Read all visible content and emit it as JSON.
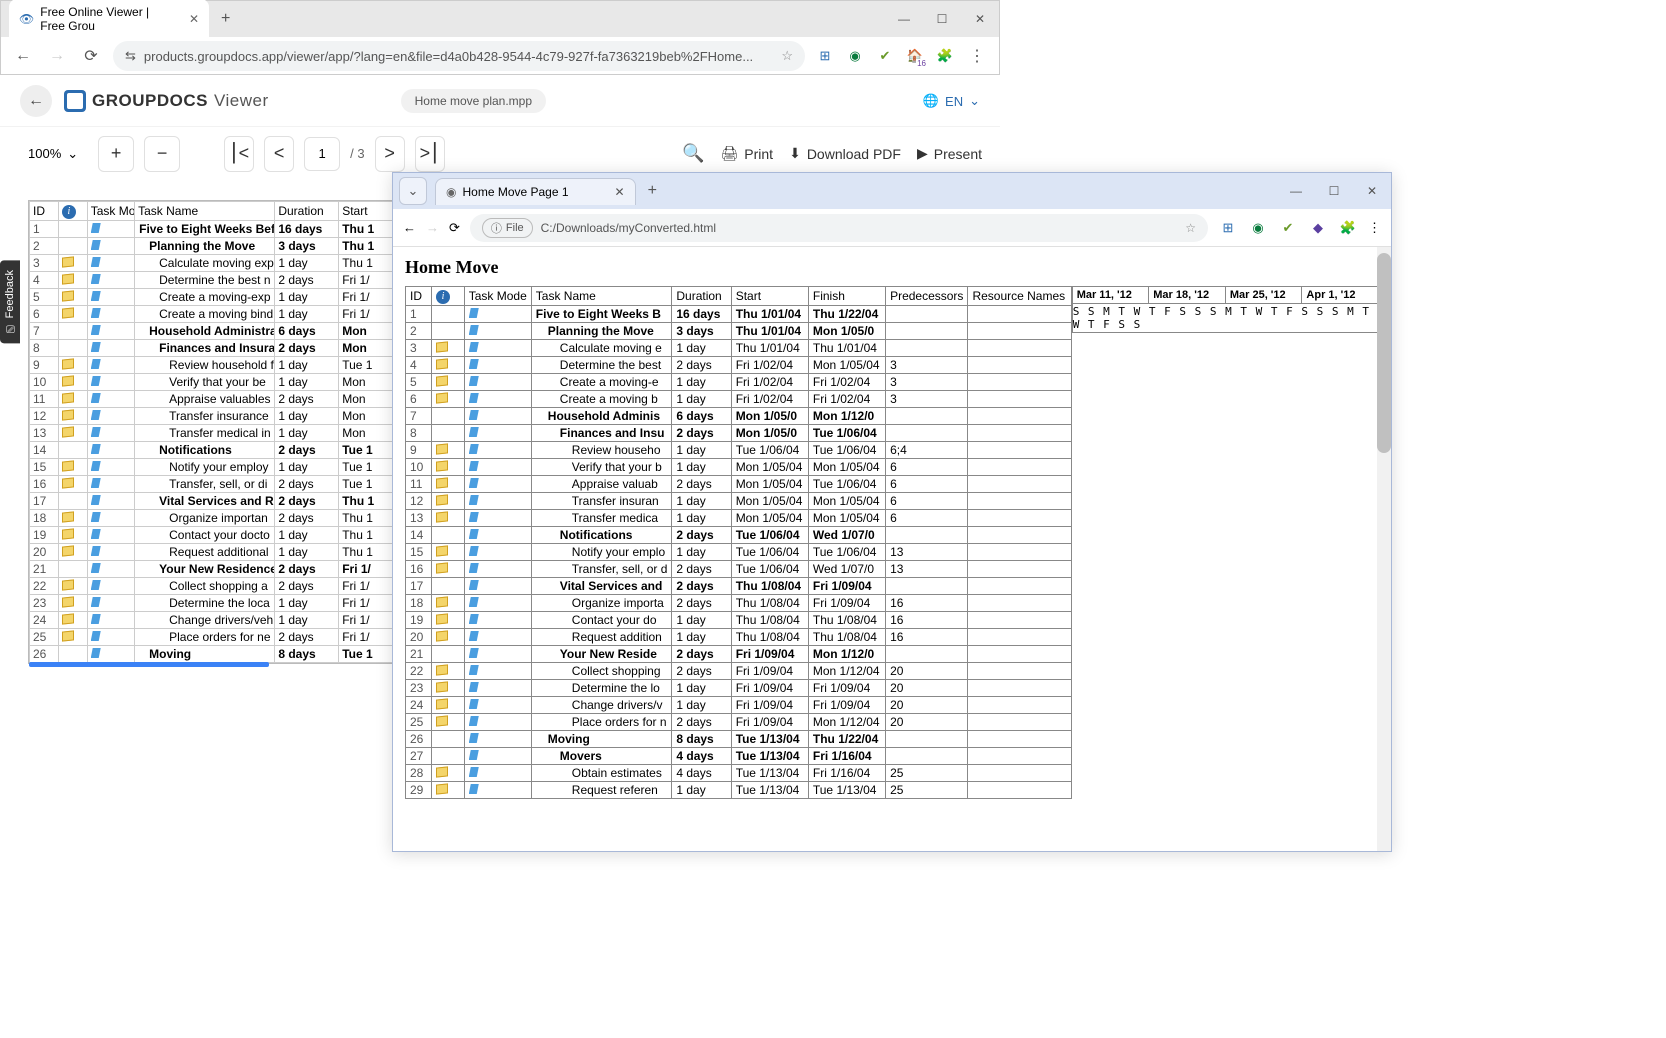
{
  "back_browser": {
    "tab_title": "Free Online Viewer | Free Grou",
    "url": "products.groupdocs.app/viewer/app/?lang=en&file=d4a0b428-9544-4c79-927f-fa7363219beb%2FHome...",
    "win_min": "—",
    "win_max": "☐",
    "win_close": "✕",
    "ext_badge": "16"
  },
  "gd": {
    "brand": "GROUPDOCS",
    "product": "Viewer",
    "file": "Home move plan.mpp",
    "lang": "EN",
    "zoom": "100%",
    "page": "1",
    "total": "/ 3",
    "print": "Print",
    "download": "Download PDF",
    "present": "Present"
  },
  "feedback": "Feedback",
  "back_table": {
    "headers": {
      "id": "ID",
      "info": "",
      "mode": "Task Mode",
      "name": "Task Name",
      "duration": "Duration",
      "start": "Start"
    },
    "rows": [
      {
        "id": "1",
        "b": true,
        "name": "Five to Eight Weeks Before",
        "dur": "16 days",
        "start": "Thu 1",
        "ind": 0,
        "note": false
      },
      {
        "id": "2",
        "b": true,
        "name": "Planning the Move",
        "dur": "3 days",
        "start": "Thu 1",
        "ind": 1,
        "note": false
      },
      {
        "id": "3",
        "b": false,
        "name": "Calculate moving exp",
        "dur": "1 day",
        "start": "Thu 1",
        "ind": 2,
        "note": true
      },
      {
        "id": "4",
        "b": false,
        "name": "Determine the best n",
        "dur": "2 days",
        "start": "Fri 1/",
        "ind": 2,
        "note": true
      },
      {
        "id": "5",
        "b": false,
        "name": "Create a moving-exp",
        "dur": "1 day",
        "start": "Fri 1/",
        "ind": 2,
        "note": true
      },
      {
        "id": "6",
        "b": false,
        "name": "Create a moving bind",
        "dur": "1 day",
        "start": "Fri 1/",
        "ind": 2,
        "note": true
      },
      {
        "id": "7",
        "b": true,
        "name": "Household Administration",
        "dur": "6 days",
        "start": "Mon",
        "ind": 1,
        "note": false
      },
      {
        "id": "8",
        "b": true,
        "name": "Finances and Insura",
        "dur": "2 days",
        "start": "Mon",
        "ind": 2,
        "note": false
      },
      {
        "id": "9",
        "b": false,
        "name": "Review household fi",
        "dur": "1 day",
        "start": "Tue 1",
        "ind": 3,
        "note": true
      },
      {
        "id": "10",
        "b": false,
        "name": "Verify that your be",
        "dur": "1 day",
        "start": "Mon",
        "ind": 3,
        "note": true
      },
      {
        "id": "11",
        "b": false,
        "name": "Appraise valuables",
        "dur": "2 days",
        "start": "Mon",
        "ind": 3,
        "note": true
      },
      {
        "id": "12",
        "b": false,
        "name": "Transfer insurance",
        "dur": "1 day",
        "start": "Mon",
        "ind": 3,
        "note": true
      },
      {
        "id": "13",
        "b": false,
        "name": "Transfer medical in",
        "dur": "1 day",
        "start": "Mon",
        "ind": 3,
        "note": true
      },
      {
        "id": "14",
        "b": true,
        "name": "Notifications",
        "dur": "2 days",
        "start": "Tue 1",
        "ind": 2,
        "note": false
      },
      {
        "id": "15",
        "b": false,
        "name": "Notify your employ",
        "dur": "1 day",
        "start": "Tue 1",
        "ind": 3,
        "note": true
      },
      {
        "id": "16",
        "b": false,
        "name": "Transfer, sell, or di",
        "dur": "2 days",
        "start": "Tue 1",
        "ind": 3,
        "note": true
      },
      {
        "id": "17",
        "b": true,
        "name": "Vital Services and R",
        "dur": "2 days",
        "start": "Thu 1",
        "ind": 2,
        "note": false
      },
      {
        "id": "18",
        "b": false,
        "name": "Organize importan",
        "dur": "2 days",
        "start": "Thu 1",
        "ind": 3,
        "note": true
      },
      {
        "id": "19",
        "b": false,
        "name": "Contact your docto",
        "dur": "1 day",
        "start": "Thu 1",
        "ind": 3,
        "note": true
      },
      {
        "id": "20",
        "b": false,
        "name": "Request additional",
        "dur": "1 day",
        "start": "Thu 1",
        "ind": 3,
        "note": true
      },
      {
        "id": "21",
        "b": true,
        "name": "Your New Residence",
        "dur": "2 days",
        "start": "Fri 1/",
        "ind": 2,
        "note": false
      },
      {
        "id": "22",
        "b": false,
        "name": "Collect shopping a",
        "dur": "2 days",
        "start": "Fri 1/",
        "ind": 3,
        "note": true
      },
      {
        "id": "23",
        "b": false,
        "name": "Determine the loca",
        "dur": "1 day",
        "start": "Fri 1/",
        "ind": 3,
        "note": true
      },
      {
        "id": "24",
        "b": false,
        "name": "Change drivers/veh",
        "dur": "1 day",
        "start": "Fri 1/",
        "ind": 3,
        "note": true
      },
      {
        "id": "25",
        "b": false,
        "name": "Place orders for ne",
        "dur": "2 days",
        "start": "Fri 1/",
        "ind": 3,
        "note": true
      },
      {
        "id": "26",
        "b": true,
        "name": "Moving",
        "dur": "8 days",
        "start": "Tue 1",
        "ind": 1,
        "note": false
      }
    ]
  },
  "front_browser": {
    "tab_title": "Home Move Page 1",
    "file_label": "File",
    "path": "C:/Downloads/myConverted.html",
    "win_min": "—",
    "win_max": "☐",
    "win_close": "✕"
  },
  "front_page": {
    "title": "Home Move",
    "headers": {
      "id": "ID",
      "mode": "Task Mode",
      "name": "Task Name",
      "dur": "Duration",
      "start": "Start",
      "finish": "Finish",
      "pred": "Predecessors",
      "res": "Resource Names"
    },
    "weeks": [
      "Mar 11, '12",
      "Mar 18, '12",
      "Mar 25, '12",
      "Apr 1, '12"
    ],
    "days": "S S M T W T F S S S M T W T F S S S M T W T F S S",
    "rows": [
      {
        "id": "1",
        "b": true,
        "name": "Five to Eight Weeks B",
        "dur": "16 days",
        "start": "Thu 1/01/04",
        "fin": "Thu 1/22/04",
        "pred": "",
        "ind": 0,
        "note": false
      },
      {
        "id": "2",
        "b": true,
        "name": "Planning the Move",
        "dur": "3 days",
        "start": "Thu 1/01/04",
        "fin": "Mon 1/05/0",
        "pred": "",
        "ind": 1,
        "note": false
      },
      {
        "id": "3",
        "b": false,
        "name": "Calculate moving e",
        "dur": "1 day",
        "start": "Thu 1/01/04",
        "fin": "Thu 1/01/04",
        "pred": "",
        "ind": 2,
        "note": true
      },
      {
        "id": "4",
        "b": false,
        "name": "Determine the best",
        "dur": "2 days",
        "start": "Fri 1/02/04",
        "fin": "Mon 1/05/04",
        "pred": "3",
        "ind": 2,
        "note": true
      },
      {
        "id": "5",
        "b": false,
        "name": "Create a moving-e",
        "dur": "1 day",
        "start": "Fri 1/02/04",
        "fin": "Fri 1/02/04",
        "pred": "3",
        "ind": 2,
        "note": true
      },
      {
        "id": "6",
        "b": false,
        "name": "Create a moving b",
        "dur": "1 day",
        "start": "Fri 1/02/04",
        "fin": "Fri 1/02/04",
        "pred": "3",
        "ind": 2,
        "note": true
      },
      {
        "id": "7",
        "b": true,
        "name": "Household Adminis",
        "dur": "6 days",
        "start": "Mon 1/05/0",
        "fin": "Mon 1/12/0",
        "pred": "",
        "ind": 1,
        "note": false
      },
      {
        "id": "8",
        "b": true,
        "name": "Finances and Insu",
        "dur": "2 days",
        "start": "Mon 1/05/0",
        "fin": "Tue 1/06/04",
        "pred": "",
        "ind": 2,
        "note": false
      },
      {
        "id": "9",
        "b": false,
        "name": "Review househo",
        "dur": "1 day",
        "start": "Tue 1/06/04",
        "fin": "Tue 1/06/04",
        "pred": "6;4",
        "ind": 3,
        "note": true
      },
      {
        "id": "10",
        "b": false,
        "name": "Verify that your b",
        "dur": "1 day",
        "start": "Mon 1/05/04",
        "fin": "Mon 1/05/04",
        "pred": "6",
        "ind": 3,
        "note": true
      },
      {
        "id": "11",
        "b": false,
        "name": "Appraise valuab",
        "dur": "2 days",
        "start": "Mon 1/05/04",
        "fin": "Tue 1/06/04",
        "pred": "6",
        "ind": 3,
        "note": true
      },
      {
        "id": "12",
        "b": false,
        "name": "Transfer insuran",
        "dur": "1 day",
        "start": "Mon 1/05/04",
        "fin": "Mon 1/05/04",
        "pred": "6",
        "ind": 3,
        "note": true
      },
      {
        "id": "13",
        "b": false,
        "name": "Transfer medica",
        "dur": "1 day",
        "start": "Mon 1/05/04",
        "fin": "Mon 1/05/04",
        "pred": "6",
        "ind": 3,
        "note": true
      },
      {
        "id": "14",
        "b": true,
        "name": "Notifications",
        "dur": "2 days",
        "start": "Tue 1/06/04",
        "fin": "Wed 1/07/0",
        "pred": "",
        "ind": 2,
        "note": false
      },
      {
        "id": "15",
        "b": false,
        "name": "Notify your emplo",
        "dur": "1 day",
        "start": "Tue 1/06/04",
        "fin": "Tue 1/06/04",
        "pred": "13",
        "ind": 3,
        "note": true
      },
      {
        "id": "16",
        "b": false,
        "name": "Transfer, sell, or d",
        "dur": "2 days",
        "start": "Tue 1/06/04",
        "fin": "Wed 1/07/0",
        "pred": "13",
        "ind": 3,
        "note": true
      },
      {
        "id": "17",
        "b": true,
        "name": "Vital Services and",
        "dur": "2 days",
        "start": "Thu 1/08/04",
        "fin": "Fri 1/09/04",
        "pred": "",
        "ind": 2,
        "note": false
      },
      {
        "id": "18",
        "b": false,
        "name": "Organize importa",
        "dur": "2 days",
        "start": "Thu 1/08/04",
        "fin": "Fri 1/09/04",
        "pred": "16",
        "ind": 3,
        "note": true
      },
      {
        "id": "19",
        "b": false,
        "name": "Contact your do",
        "dur": "1 day",
        "start": "Thu 1/08/04",
        "fin": "Thu 1/08/04",
        "pred": "16",
        "ind": 3,
        "note": true
      },
      {
        "id": "20",
        "b": false,
        "name": "Request addition",
        "dur": "1 day",
        "start": "Thu 1/08/04",
        "fin": "Thu 1/08/04",
        "pred": "16",
        "ind": 3,
        "note": true
      },
      {
        "id": "21",
        "b": true,
        "name": "Your New Reside",
        "dur": "2 days",
        "start": "Fri 1/09/04",
        "fin": "Mon 1/12/0",
        "pred": "",
        "ind": 2,
        "note": false
      },
      {
        "id": "22",
        "b": false,
        "name": "Collect shopping",
        "dur": "2 days",
        "start": "Fri 1/09/04",
        "fin": "Mon 1/12/04",
        "pred": "20",
        "ind": 3,
        "note": true
      },
      {
        "id": "23",
        "b": false,
        "name": "Determine the lo",
        "dur": "1 day",
        "start": "Fri 1/09/04",
        "fin": "Fri 1/09/04",
        "pred": "20",
        "ind": 3,
        "note": true
      },
      {
        "id": "24",
        "b": false,
        "name": "Change drivers/v",
        "dur": "1 day",
        "start": "Fri 1/09/04",
        "fin": "Fri 1/09/04",
        "pred": "20",
        "ind": 3,
        "note": true
      },
      {
        "id": "25",
        "b": false,
        "name": "Place orders for n",
        "dur": "2 days",
        "start": "Fri 1/09/04",
        "fin": "Mon 1/12/04",
        "pred": "20",
        "ind": 3,
        "note": true
      },
      {
        "id": "26",
        "b": true,
        "name": "Moving",
        "dur": "8 days",
        "start": "Tue 1/13/04",
        "fin": "Thu 1/22/04",
        "pred": "",
        "ind": 1,
        "note": false
      },
      {
        "id": "27",
        "b": true,
        "name": "Movers",
        "dur": "4 days",
        "start": "Tue 1/13/04",
        "fin": "Fri 1/16/04",
        "pred": "",
        "ind": 2,
        "note": false
      },
      {
        "id": "28",
        "b": false,
        "name": "Obtain estimates",
        "dur": "4 days",
        "start": "Tue 1/13/04",
        "fin": "Fri 1/16/04",
        "pred": "25",
        "ind": 3,
        "note": true
      },
      {
        "id": "29",
        "b": false,
        "name": "Request referen",
        "dur": "1 day",
        "start": "Tue 1/13/04",
        "fin": "Tue 1/13/04",
        "pred": "25",
        "ind": 3,
        "note": true
      }
    ]
  }
}
